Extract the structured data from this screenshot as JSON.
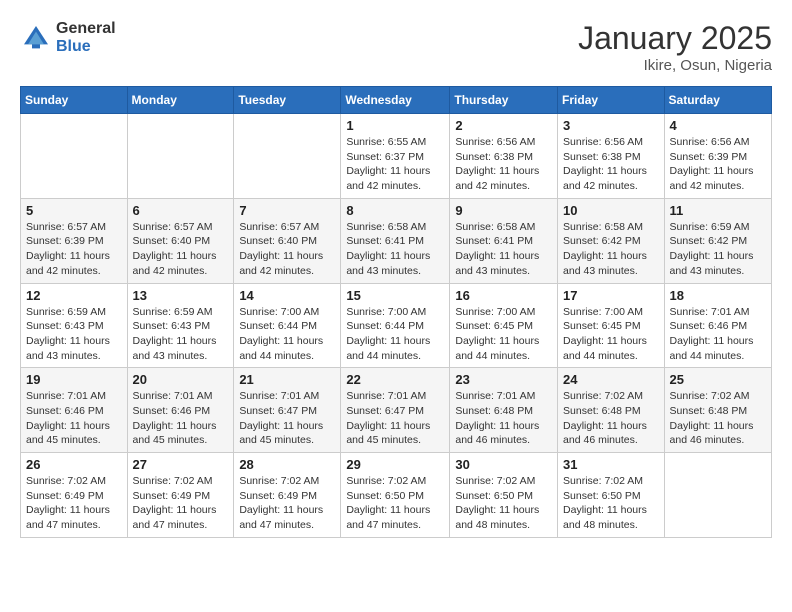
{
  "logo": {
    "general": "General",
    "blue": "Blue"
  },
  "title": {
    "month": "January 2025",
    "location": "Ikire, Osun, Nigeria"
  },
  "weekdays": [
    "Sunday",
    "Monday",
    "Tuesday",
    "Wednesday",
    "Thursday",
    "Friday",
    "Saturday"
  ],
  "weeks": [
    [
      {
        "day": "",
        "info": ""
      },
      {
        "day": "",
        "info": ""
      },
      {
        "day": "",
        "info": ""
      },
      {
        "day": "1",
        "info": "Sunrise: 6:55 AM\nSunset: 6:37 PM\nDaylight: 11 hours and 42 minutes."
      },
      {
        "day": "2",
        "info": "Sunrise: 6:56 AM\nSunset: 6:38 PM\nDaylight: 11 hours and 42 minutes."
      },
      {
        "day": "3",
        "info": "Sunrise: 6:56 AM\nSunset: 6:38 PM\nDaylight: 11 hours and 42 minutes."
      },
      {
        "day": "4",
        "info": "Sunrise: 6:56 AM\nSunset: 6:39 PM\nDaylight: 11 hours and 42 minutes."
      }
    ],
    [
      {
        "day": "5",
        "info": "Sunrise: 6:57 AM\nSunset: 6:39 PM\nDaylight: 11 hours and 42 minutes."
      },
      {
        "day": "6",
        "info": "Sunrise: 6:57 AM\nSunset: 6:40 PM\nDaylight: 11 hours and 42 minutes."
      },
      {
        "day": "7",
        "info": "Sunrise: 6:57 AM\nSunset: 6:40 PM\nDaylight: 11 hours and 42 minutes."
      },
      {
        "day": "8",
        "info": "Sunrise: 6:58 AM\nSunset: 6:41 PM\nDaylight: 11 hours and 43 minutes."
      },
      {
        "day": "9",
        "info": "Sunrise: 6:58 AM\nSunset: 6:41 PM\nDaylight: 11 hours and 43 minutes."
      },
      {
        "day": "10",
        "info": "Sunrise: 6:58 AM\nSunset: 6:42 PM\nDaylight: 11 hours and 43 minutes."
      },
      {
        "day": "11",
        "info": "Sunrise: 6:59 AM\nSunset: 6:42 PM\nDaylight: 11 hours and 43 minutes."
      }
    ],
    [
      {
        "day": "12",
        "info": "Sunrise: 6:59 AM\nSunset: 6:43 PM\nDaylight: 11 hours and 43 minutes."
      },
      {
        "day": "13",
        "info": "Sunrise: 6:59 AM\nSunset: 6:43 PM\nDaylight: 11 hours and 43 minutes."
      },
      {
        "day": "14",
        "info": "Sunrise: 7:00 AM\nSunset: 6:44 PM\nDaylight: 11 hours and 44 minutes."
      },
      {
        "day": "15",
        "info": "Sunrise: 7:00 AM\nSunset: 6:44 PM\nDaylight: 11 hours and 44 minutes."
      },
      {
        "day": "16",
        "info": "Sunrise: 7:00 AM\nSunset: 6:45 PM\nDaylight: 11 hours and 44 minutes."
      },
      {
        "day": "17",
        "info": "Sunrise: 7:00 AM\nSunset: 6:45 PM\nDaylight: 11 hours and 44 minutes."
      },
      {
        "day": "18",
        "info": "Sunrise: 7:01 AM\nSunset: 6:46 PM\nDaylight: 11 hours and 44 minutes."
      }
    ],
    [
      {
        "day": "19",
        "info": "Sunrise: 7:01 AM\nSunset: 6:46 PM\nDaylight: 11 hours and 45 minutes."
      },
      {
        "day": "20",
        "info": "Sunrise: 7:01 AM\nSunset: 6:46 PM\nDaylight: 11 hours and 45 minutes."
      },
      {
        "day": "21",
        "info": "Sunrise: 7:01 AM\nSunset: 6:47 PM\nDaylight: 11 hours and 45 minutes."
      },
      {
        "day": "22",
        "info": "Sunrise: 7:01 AM\nSunset: 6:47 PM\nDaylight: 11 hours and 45 minutes."
      },
      {
        "day": "23",
        "info": "Sunrise: 7:01 AM\nSunset: 6:48 PM\nDaylight: 11 hours and 46 minutes."
      },
      {
        "day": "24",
        "info": "Sunrise: 7:02 AM\nSunset: 6:48 PM\nDaylight: 11 hours and 46 minutes."
      },
      {
        "day": "25",
        "info": "Sunrise: 7:02 AM\nSunset: 6:48 PM\nDaylight: 11 hours and 46 minutes."
      }
    ],
    [
      {
        "day": "26",
        "info": "Sunrise: 7:02 AM\nSunset: 6:49 PM\nDaylight: 11 hours and 47 minutes."
      },
      {
        "day": "27",
        "info": "Sunrise: 7:02 AM\nSunset: 6:49 PM\nDaylight: 11 hours and 47 minutes."
      },
      {
        "day": "28",
        "info": "Sunrise: 7:02 AM\nSunset: 6:49 PM\nDaylight: 11 hours and 47 minutes."
      },
      {
        "day": "29",
        "info": "Sunrise: 7:02 AM\nSunset: 6:50 PM\nDaylight: 11 hours and 47 minutes."
      },
      {
        "day": "30",
        "info": "Sunrise: 7:02 AM\nSunset: 6:50 PM\nDaylight: 11 hours and 48 minutes."
      },
      {
        "day": "31",
        "info": "Sunrise: 7:02 AM\nSunset: 6:50 PM\nDaylight: 11 hours and 48 minutes."
      },
      {
        "day": "",
        "info": ""
      }
    ]
  ]
}
